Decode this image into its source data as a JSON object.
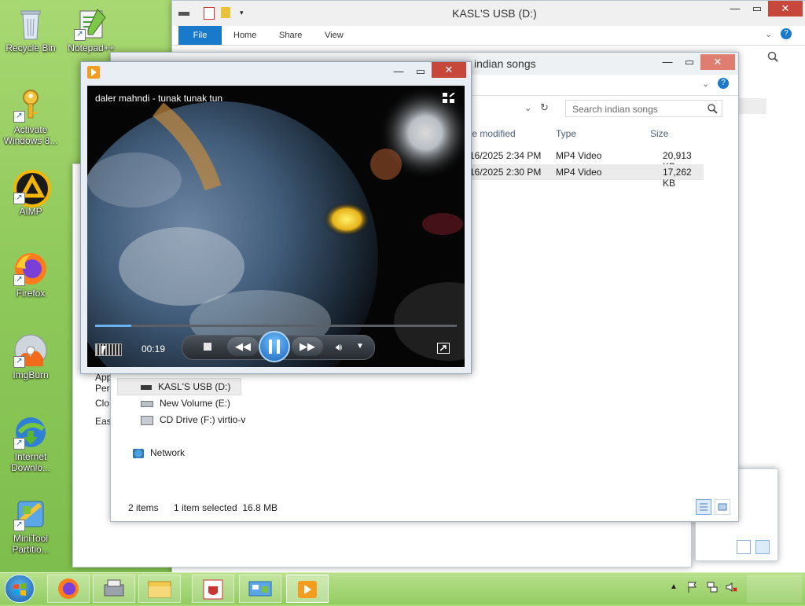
{
  "desktop": {
    "icons": [
      {
        "label": "Recycle Bin"
      },
      {
        "label": "Notepad++"
      },
      {
        "label": "Activate Windows 8..."
      },
      {
        "label": "AIMP"
      },
      {
        "label": "Firefox"
      },
      {
        "label": "ImgBurn"
      },
      {
        "label": "Internet Downlo..."
      },
      {
        "label": "MiniTool Partitio..."
      }
    ]
  },
  "explorer_back": {
    "title": "KASL'S USB (D:)",
    "tabs": [
      "File",
      "Home",
      "Share",
      "View"
    ]
  },
  "explorer_front": {
    "title": "indian songs",
    "search_placeholder": "Search indian songs",
    "columns": [
      "te modified",
      "Type",
      "Size"
    ],
    "rows": [
      {
        "date": "16/2025 2:34 PM",
        "type": "MP4 Video",
        "size": "20,913 KB"
      },
      {
        "date": "16/2025 2:30 PM",
        "type": "MP4 Video",
        "size": "17,262 KB"
      }
    ],
    "nav": [
      {
        "label": "KASL'S USB (D:)"
      },
      {
        "label": "New Volume (E:)"
      },
      {
        "label": "CD Drive (F:) virtio-v"
      },
      {
        "label": "Network"
      }
    ],
    "left_fragments": [
      "App",
      "Pers",
      "Clo",
      "Eas"
    ],
    "status": {
      "items": "2 items",
      "selected": "1 item selected  16.8 MB"
    }
  },
  "player": {
    "video_title": "daler mahndi - tunak tunak tun",
    "time": "00:19",
    "progress": 0.1
  },
  "colors": {
    "accent": "#1979ca",
    "close": "#c7473a"
  }
}
